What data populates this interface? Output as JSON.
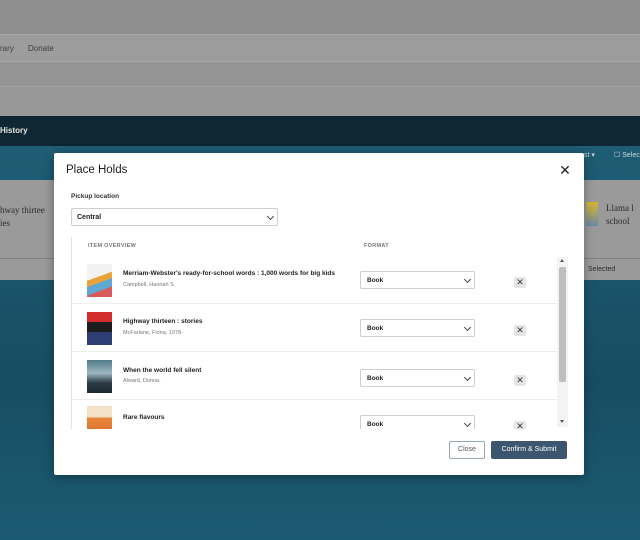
{
  "background": {
    "nav_items": [
      "rary",
      "Donate"
    ],
    "dark_bar_label": "History",
    "bar_partial_1": "st ▾",
    "bar_partial_2": "☐ Selec",
    "left_card_title_1": "hway thirtee",
    "left_card_title_2": "ies",
    "right_card_title_1": "Llama l",
    "right_card_title_2": "school",
    "right_card_selected": "Selected"
  },
  "modal": {
    "title": "Place Holds",
    "close_symbol": "✕",
    "pickup_label": "Pickup location",
    "pickup_value": "Central",
    "columns": {
      "overview": "ITEM OVERVIEW",
      "format": "FORMAT"
    },
    "items": [
      {
        "title": "Merriam-Webster's ready-for-school words : 1,000 words for big kids",
        "author": "Campbell, Hannah S.",
        "format": "Book",
        "cover": "cover-icon"
      },
      {
        "title": "Highway thirteen : stories",
        "author": "McFarlane, Fiona, 1978-",
        "format": "Book",
        "cover": "cover-icon"
      },
      {
        "title": "When the world fell silent",
        "author": "Alward, Donna.",
        "format": "Book",
        "cover": "cover-icon"
      },
      {
        "title": "Rare flavours",
        "author": "",
        "format": "Book",
        "cover": "cover-icon"
      }
    ],
    "remove_symbol": "✕",
    "close_button": "Close",
    "confirm_button": "Confirm & Submit"
  },
  "colors": {
    "primary_button": "#3d566f",
    "header_dark": "#0f2633",
    "page_blue": "#1e5d74"
  }
}
